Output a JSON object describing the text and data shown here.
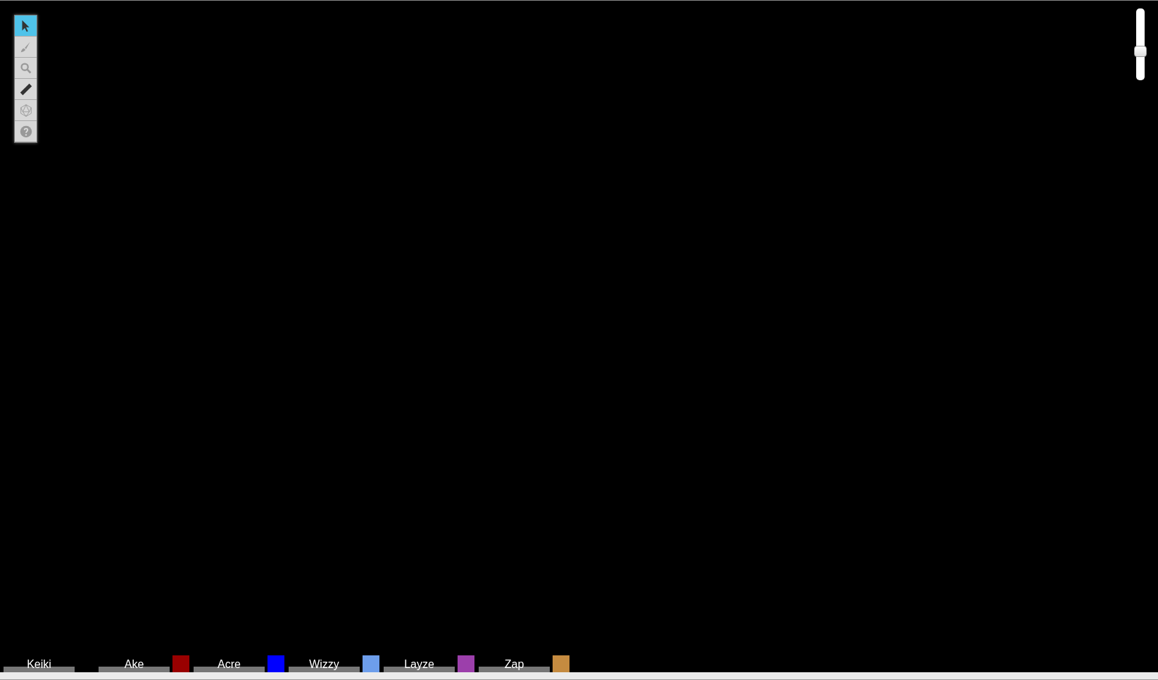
{
  "toolbar": {
    "tools": [
      {
        "kind": "pointer",
        "selected": true
      },
      {
        "kind": "brush",
        "selected": false
      },
      {
        "kind": "zoom",
        "selected": false
      },
      {
        "kind": "ruler",
        "selected": false
      },
      {
        "kind": "dice",
        "selected": false
      },
      {
        "kind": "help",
        "selected": false
      }
    ]
  },
  "zoom_slider": {
    "level": 0.38
  },
  "players": [
    {
      "name": "Keiki"
    },
    {
      "name": "Ake",
      "color": "#990000"
    },
    {
      "name": "Acre",
      "color": "#0000ff"
    },
    {
      "name": "Wizzy",
      "color": "#6d9eeb"
    },
    {
      "name": "Layze",
      "color": "#9c3fab"
    },
    {
      "name": "Zap",
      "color": "#c58b40"
    }
  ]
}
